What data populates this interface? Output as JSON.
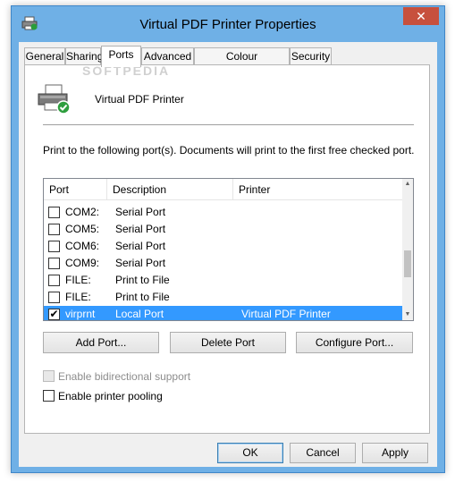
{
  "window": {
    "title": "Virtual PDF Printer Properties",
    "close_glyph": "✕",
    "app_icon": "printer-icon"
  },
  "tabs": [
    {
      "label": "General"
    },
    {
      "label": "Sharing"
    },
    {
      "label": "Ports",
      "active": true
    },
    {
      "label": "Advanced"
    },
    {
      "label": "Colour Management"
    },
    {
      "label": "Security"
    }
  ],
  "printer": {
    "name": "Virtual PDF Printer",
    "icon": "printer-check-icon"
  },
  "description": "Print to the following port(s). Documents will print to the first free checked port.",
  "ports_list": {
    "columns": [
      "Port",
      "Description",
      "Printer"
    ],
    "rows": [
      {
        "port": "COM2:",
        "description": "Serial Port",
        "printer": "",
        "checked": false
      },
      {
        "port": "COM5:",
        "description": "Serial Port",
        "printer": "",
        "checked": false
      },
      {
        "port": "COM6:",
        "description": "Serial Port",
        "printer": "",
        "checked": false
      },
      {
        "port": "COM9:",
        "description": "Serial Port",
        "printer": "",
        "checked": false
      },
      {
        "port": "FILE:",
        "description": "Print to File",
        "printer": "",
        "checked": false
      },
      {
        "port": "FILE:",
        "description": "Print to File",
        "printer": "",
        "checked": false
      },
      {
        "port": "virprnt",
        "description": "Local Port",
        "printer": "Virtual PDF Printer",
        "checked": true,
        "selected": true
      }
    ]
  },
  "buttons": {
    "add_port": "Add Port...",
    "delete_port": "Delete Port",
    "configure_port": "Configure Port..."
  },
  "options": {
    "bidirectional": {
      "label": "Enable bidirectional support",
      "checked": false,
      "disabled": true
    },
    "pooling": {
      "label": "Enable printer pooling",
      "checked": false
    }
  },
  "footer": {
    "ok": "OK",
    "cancel": "Cancel",
    "apply": "Apply"
  },
  "colors": {
    "accent": "#3399ff",
    "title_bar": "#6fb0e6",
    "close": "#c7503d"
  }
}
